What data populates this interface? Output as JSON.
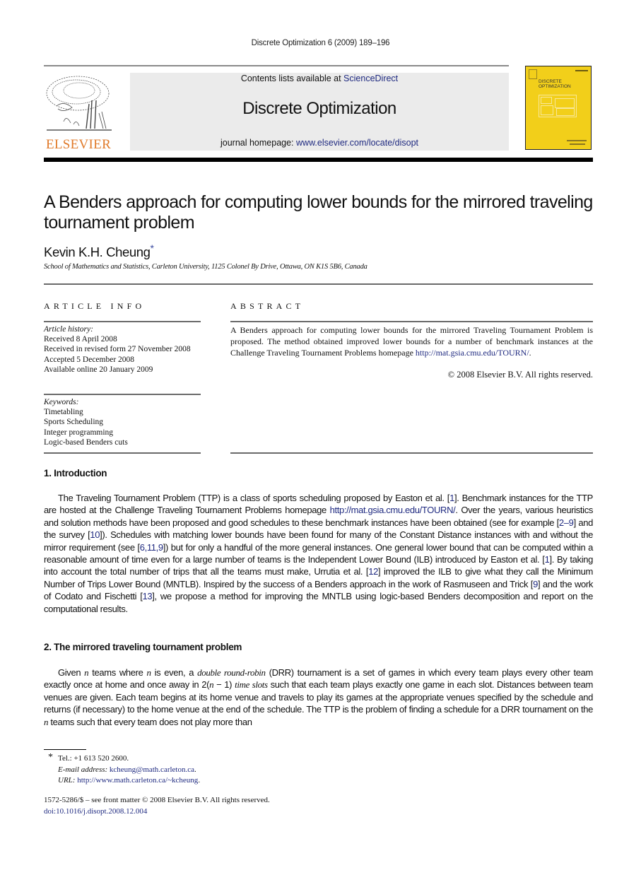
{
  "running_header": "Discrete Optimization 6 (2009) 189–196",
  "masthead": {
    "publisher_logo_text": "ELSEVIER",
    "contents_prefix": "Contents lists available at ",
    "contents_link": "ScienceDirect",
    "journal_name": "Discrete Optimization",
    "homepage_prefix": "journal homepage: ",
    "homepage_link": "www.elsevier.com/locate/disopt",
    "cover_title_line1": "DISCRETE",
    "cover_title_line2": "OPTIMIZATION",
    "logo_color": "#e07a2a",
    "cover_color": "#f2cf1a",
    "link_color": "#1f2a80"
  },
  "article": {
    "title": "A Benders approach for computing lower bounds for the mirrored traveling tournament problem",
    "author": "Kevin K.H. Cheung",
    "author_mark": "*",
    "affiliation": "School of Mathematics and Statistics, Carleton University, 1125 Colonel By Drive, Ottawa, ON K1S 5B6, Canada"
  },
  "article_info": {
    "heading": "ARTICLE INFO",
    "history_label": "Article history:",
    "history": [
      "Received 8 April 2008",
      "Received in revised form 27 November 2008",
      "Accepted 5 December 2008",
      "Available online 20 January 2009"
    ],
    "keywords_label": "Keywords:",
    "keywords": [
      "Timetabling",
      "Sports Scheduling",
      "Integer programming",
      "Logic-based Benders cuts"
    ]
  },
  "abstract": {
    "heading": "ABSTRACT",
    "text": "A Benders approach for computing lower bounds for the mirrored Traveling Tournament Problem is proposed. The method obtained improved lower bounds for a number of benchmark instances at the Challenge Traveling Tournament Problems homepage ",
    "link": "http://mat.gsia.cmu.edu/TOURN/",
    "link_suffix": ".",
    "copyright": "© 2008 Elsevier B.V. All rights reserved."
  },
  "sections": [
    {
      "heading": "1.  Introduction",
      "segments": [
        {
          "t": "The Traveling Tournament Problem (TTP) is a class of sports scheduling proposed by Easton et al. ["
        },
        {
          "t": "1",
          "link": true
        },
        {
          "t": "]. Benchmark instances for the TTP are hosted at the Challenge Traveling Tournament Problems homepage "
        },
        {
          "t": "http://mat.gsia.cmu.edu/TOURN/",
          "link": true
        },
        {
          "t": ". Over the years, various heuristics and solution methods have been proposed and good schedules to these benchmark instances have been obtained (see for example ["
        },
        {
          "t": "2–9",
          "link": true
        },
        {
          "t": "] and the survey ["
        },
        {
          "t": "10",
          "link": true
        },
        {
          "t": "]). Schedules with matching lower bounds have been found for many of the Constant Distance instances with and without the mirror requirement (see ["
        },
        {
          "t": "6,11,9",
          "link": true
        },
        {
          "t": "]) but for only a handful of the more general instances. One general lower bound that can be computed within a reasonable amount of time even for a large number of teams is the Independent Lower Bound (ILB) introduced by Easton et al. ["
        },
        {
          "t": "1",
          "link": true
        },
        {
          "t": "]. By taking into account the total number of trips that all the teams must make, Urrutia et al. ["
        },
        {
          "t": "12",
          "link": true
        },
        {
          "t": "] improved the ILB to give what they call the Minimum Number of Trips Lower Bound (MNTLB). Inspired by the success of a Benders approach in the work of Rasmuseen and Trick ["
        },
        {
          "t": "9",
          "link": true
        },
        {
          "t": "] and the work of Codato and Fischetti ["
        },
        {
          "t": "13",
          "link": true
        },
        {
          "t": "], we propose a method for improving the MNTLB using logic-based Benders decomposition and report on the computational results."
        }
      ]
    },
    {
      "heading": "2.  The mirrored traveling tournament problem",
      "segments": [
        {
          "t": "Given "
        },
        {
          "t": "n",
          "italic": true
        },
        {
          "t": " teams where "
        },
        {
          "t": "n",
          "italic": true
        },
        {
          "t": " is even, a "
        },
        {
          "t": "double round-robin",
          "italic": true
        },
        {
          "t": " (DRR) tournament is a set of games in which every team plays every other team exactly once at home and once away in 2("
        },
        {
          "t": "n",
          "italic": true
        },
        {
          "t": " − 1) "
        },
        {
          "t": "time slots",
          "italic": true
        },
        {
          "t": " such that each team plays exactly one game in each slot. Distances between team venues are given. Each team begins at its home venue and travels to play its games at the appropriate venues specified by the schedule and returns (if necessary) to the home venue at the end of the schedule. The TTP is the problem of finding a schedule for a DRR tournament on the "
        },
        {
          "t": "n",
          "italic": true
        },
        {
          "t": " teams such that every team does not play more than"
        }
      ]
    }
  ],
  "footnotes": {
    "mark": "*",
    "tel": "Tel.: +1 613 520 2600.",
    "email_label": "E-mail address: ",
    "email": "kcheung@math.carleton.ca",
    "url_label": "URL: ",
    "url": "http://www.math.carleton.ca/~kcheung"
  },
  "front_matter": {
    "issn_line": "1572-5286/$ – see front matter © 2008 Elsevier B.V. All rights reserved.",
    "doi": "doi:10.1016/j.disopt.2008.12.004"
  }
}
